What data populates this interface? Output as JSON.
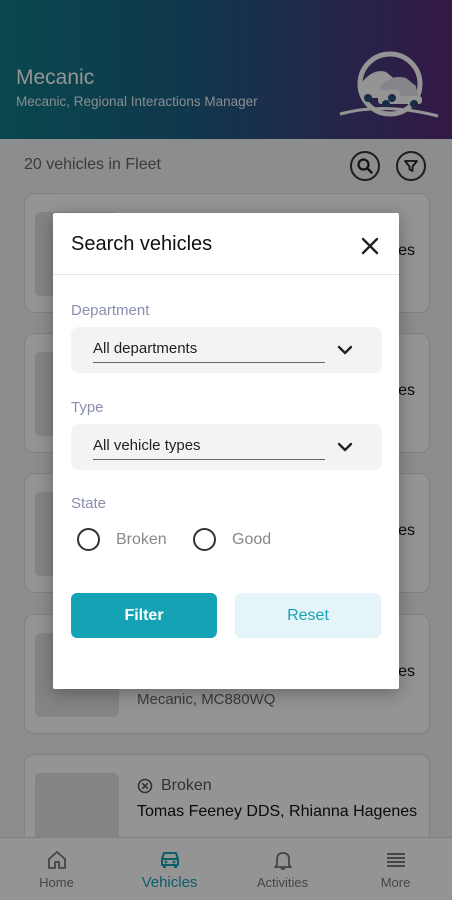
{
  "header": {
    "title": "Mecanic",
    "subtitle": "Mecanic, Regional Interactions Manager"
  },
  "fleet": {
    "count_text": "20 vehicles in Fleet"
  },
  "cards": [
    {
      "fragment": "es"
    },
    {
      "fragment": "es"
    },
    {
      "fragment": "es"
    },
    {
      "fragment": "es",
      "meta": "Mecanic, MC880WQ"
    },
    {
      "state": "Broken",
      "name": "Tomas Feeney DDS, Rhianna Hagenes"
    }
  ],
  "dialog": {
    "title": "Search vehicles",
    "department_label": "Department",
    "department_value": "All departments",
    "type_label": "Type",
    "type_value": "All vehicle types",
    "state_label": "State",
    "state_options": [
      "Broken",
      "Good"
    ],
    "filter_label": "Filter",
    "reset_label": "Reset"
  },
  "nav": {
    "items": [
      {
        "label": "Home",
        "icon": "home-icon"
      },
      {
        "label": "Vehicles",
        "icon": "car-icon"
      },
      {
        "label": "Activities",
        "icon": "bell-icon"
      },
      {
        "label": "More",
        "icon": "menu-icon"
      }
    ],
    "active": "Vehicles"
  },
  "colors": {
    "accent": "#16a2b5",
    "header_start": "#0e7c86",
    "header_end": "#5a2a78"
  }
}
